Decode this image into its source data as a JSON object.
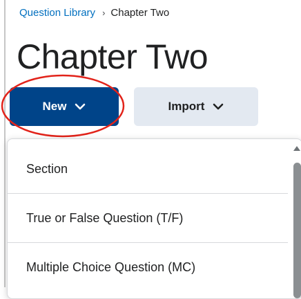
{
  "breadcrumb": {
    "parent": "Question Library",
    "separator_icon": "chevron-right-icon",
    "current": "Chapter Two"
  },
  "page": {
    "title": "Chapter Two"
  },
  "toolbar": {
    "new_label": "New",
    "new_icon": "chevron-down-icon",
    "import_label": "Import",
    "import_icon": "chevron-down-icon"
  },
  "new_menu": {
    "items": [
      {
        "label": "Section"
      },
      {
        "label": "True or False Question (T/F)"
      },
      {
        "label": "Multiple Choice Question (MC)"
      }
    ]
  },
  "colors": {
    "link": "#006fbf",
    "primary_button": "#004489",
    "secondary_button": "#e3e9f1",
    "annotation": "#e2231a",
    "text": "#202122"
  }
}
